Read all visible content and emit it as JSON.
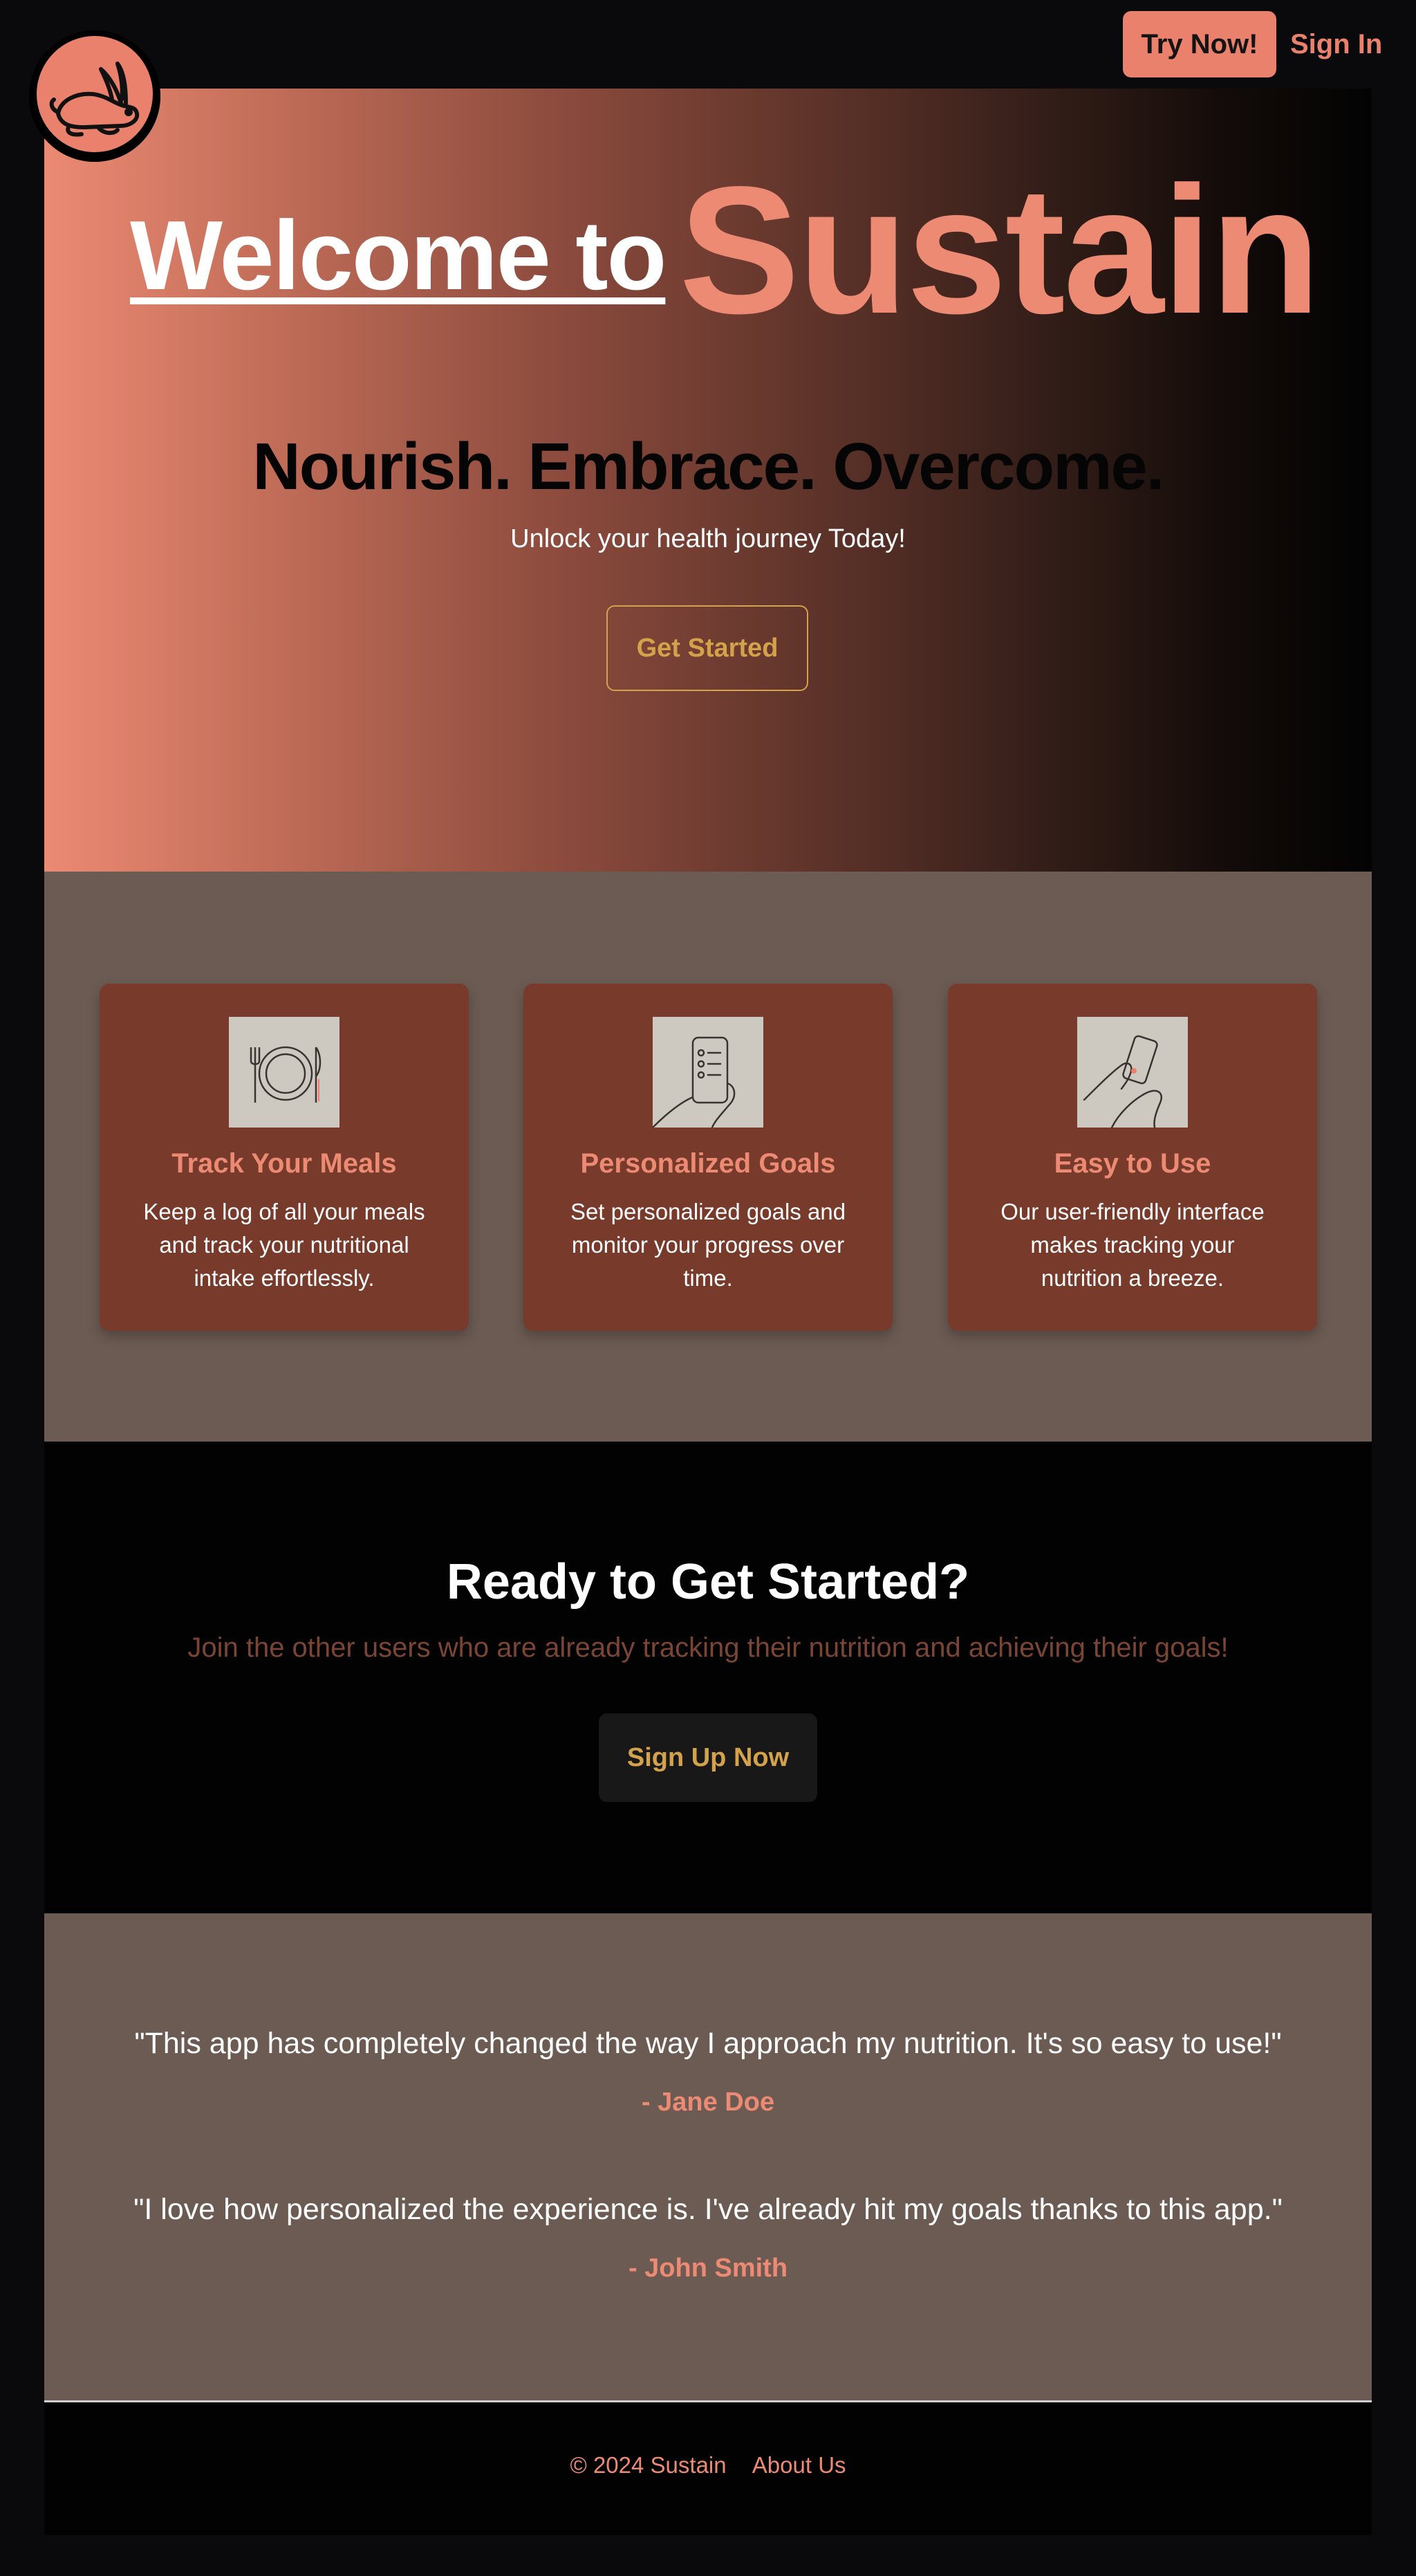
{
  "nav": {
    "try_label": "Try Now!",
    "signin_label": "Sign In"
  },
  "hero": {
    "welcome": "Welcome to",
    "brand": "Sustain",
    "tagline": "Nourish. Embrace. Overcome.",
    "subtitle": "Unlock your health journey Today!",
    "cta_label": "Get Started"
  },
  "features": [
    {
      "title": "Track Your Meals",
      "description": "Keep a log of all your meals and track your nutritional intake effortlessly.",
      "icon": "plate-utensils-icon"
    },
    {
      "title": "Personalized Goals",
      "description": "Set personalized goals and monitor your progress over time.",
      "icon": "phone-checklist-icon"
    },
    {
      "title": "Easy to Use",
      "description": "Our user-friendly interface makes tracking your nutrition a breeze.",
      "icon": "hand-phone-icon"
    }
  ],
  "cta": {
    "title": "Ready to Get Started?",
    "subtitle": "Join the other users who are already tracking their nutrition and achieving their goals!",
    "button_label": "Sign Up Now"
  },
  "testimonials": [
    {
      "quote": "\"This app has completely changed the way I approach my nutrition. It's so easy to use!\"",
      "author": "- Jane Doe"
    },
    {
      "quote": "\"I love how personalized the experience is. I've already hit my goals thanks to this app.\"",
      "author": "- John Smith"
    }
  ],
  "footer": {
    "copyright": "© 2024 Sustain",
    "about_label": "About Us"
  },
  "colors": {
    "accent": "#ec8a74",
    "gold": "#d4a24a",
    "card": "#773a2b",
    "section_mid": "#6b5b53",
    "dark": "#020202"
  },
  "logo_icon": "rabbit-logo-icon"
}
